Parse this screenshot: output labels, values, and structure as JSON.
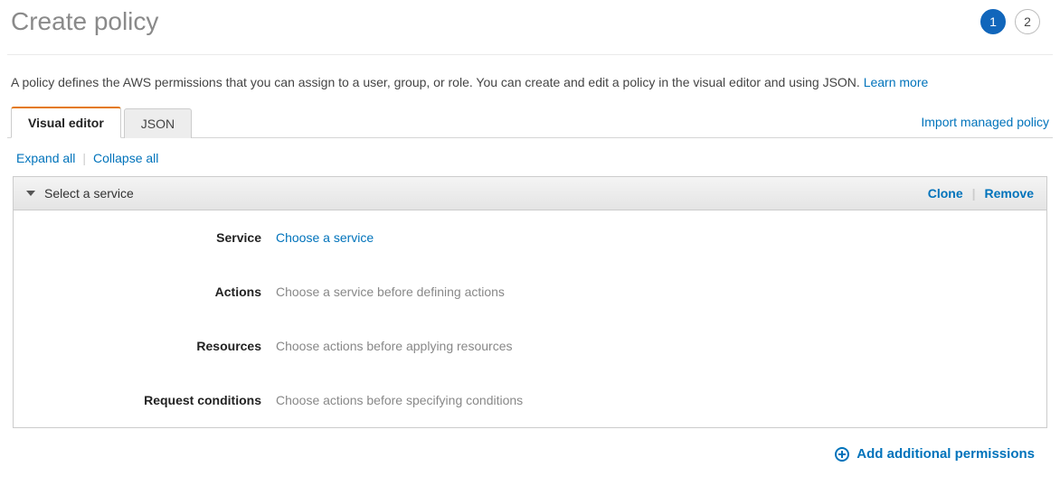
{
  "header": {
    "title": "Create policy",
    "steps": [
      "1",
      "2"
    ],
    "active_step_index": 0
  },
  "description": {
    "text": "A policy defines the AWS permissions that you can assign to a user, group, or role. You can create and edit a policy in the visual editor and using JSON. ",
    "learn_more": "Learn more"
  },
  "tabs": {
    "items": [
      "Visual editor",
      "JSON"
    ],
    "import_link": "Import managed policy"
  },
  "controls": {
    "expand_all": "Expand all",
    "collapse_all": "Collapse all"
  },
  "panel": {
    "header_title": "Select a service",
    "clone": "Clone",
    "remove": "Remove",
    "rows": {
      "service": {
        "label": "Service",
        "value": "Choose a service"
      },
      "actions": {
        "label": "Actions",
        "value": "Choose a service before defining actions"
      },
      "resources": {
        "label": "Resources",
        "value": "Choose actions before applying resources"
      },
      "conditions": {
        "label": "Request conditions",
        "value": "Choose actions before specifying conditions"
      }
    }
  },
  "footer": {
    "add_permissions": "Add additional permissions"
  }
}
